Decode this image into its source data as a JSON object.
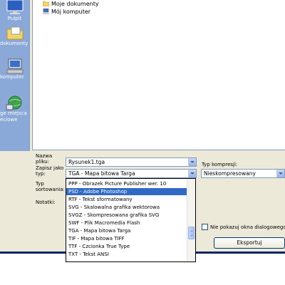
{
  "sidebar": {
    "items": [
      {
        "label": "Pulpit",
        "icon": "desktop-icon"
      },
      {
        "label": "dokumenty",
        "icon": "my-documents-icon"
      },
      {
        "label": "komputer",
        "icon": "my-computer-icon"
      },
      {
        "label_line1": "ge miejsca",
        "label_line2": "eciowe",
        "icon": "network-places-icon"
      }
    ]
  },
  "file_list": {
    "items": [
      {
        "label": "Moje dokumenty",
        "icon": "folder-icon"
      },
      {
        "label": "Mój komputer",
        "icon": "computer-icon"
      }
    ]
  },
  "form": {
    "filename_label_line1": "Nazwa",
    "filename_label_line2": "pliku:",
    "filename_value": "Rysunek1.tga",
    "save_as_label_line1": "Zapisz jako",
    "save_as_label_line2": "typ:",
    "save_as_value": "TGA - Mapa bitowa Targa",
    "sort_label_line1": "Typ",
    "sort_label_line2": "sortowania:",
    "notes_label": "Notatki:",
    "compression_label": "Typ kompresji:",
    "compression_value": "Nieskompresowany",
    "hide_dialog_label": "Nie pokazuj okna dialogowego f",
    "export_button": "Eksportuj"
  },
  "dropdown": {
    "options": [
      "PPP - Obrazek Picture Publisher wer. 10",
      "PSD - Adobe Photoshop",
      "RTF - Tekst sformatowany",
      "SVG - Skalowalna grafika wektorowa",
      "SVGZ - Skompresowana grafika SVG",
      "SWF - Plik Macromedia Flash",
      "TGA - Mapa bitowa Targa",
      "TIF - Mapa bitowa TIFF",
      "TTF - Czcionka True Type",
      "TXT - Tekst ANSI"
    ],
    "selected": "PSD - Adobe Photoshop"
  },
  "colors": {
    "sidebar_bg": "#8aa8d8",
    "dialog_bg": "#ece9d8",
    "selection": "#316ac5",
    "border": "#7f9db9"
  }
}
